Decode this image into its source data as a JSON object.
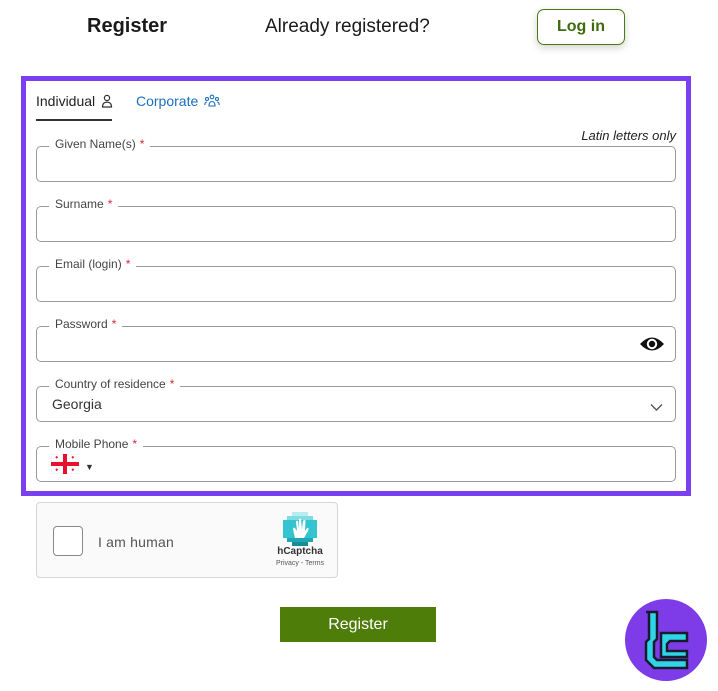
{
  "header": {
    "title": "Register",
    "question": "Already registered?",
    "login_label": "Log in"
  },
  "tabs": [
    {
      "label": "Individual",
      "active": true,
      "icon": "person-icon"
    },
    {
      "label": "Corporate",
      "active": false,
      "icon": "group-icon"
    }
  ],
  "form": {
    "latin_note": "Latin letters only",
    "required_mark": "*",
    "given_name": {
      "label": "Given Name(s)",
      "value": ""
    },
    "surname": {
      "label": "Surname",
      "value": ""
    },
    "email": {
      "label": "Email (login)",
      "value": ""
    },
    "password": {
      "label": "Password",
      "value": "",
      "icon": "eye-icon"
    },
    "country": {
      "label": "Country of residence",
      "value": "Georgia",
      "icon": "chevron-down-icon"
    },
    "phone": {
      "label": "Mobile Phone",
      "value": "",
      "flag": "georgia-flag-icon"
    }
  },
  "captcha": {
    "label": "I am human",
    "brand": "hCaptcha",
    "links": "Privacy - Terms"
  },
  "register_label": "Register",
  "colors": {
    "accent_green": "#4e7d0a",
    "frame_purple": "#7b3ff2",
    "link_blue": "#1a6fbf",
    "required_red": "#d22a3a"
  }
}
